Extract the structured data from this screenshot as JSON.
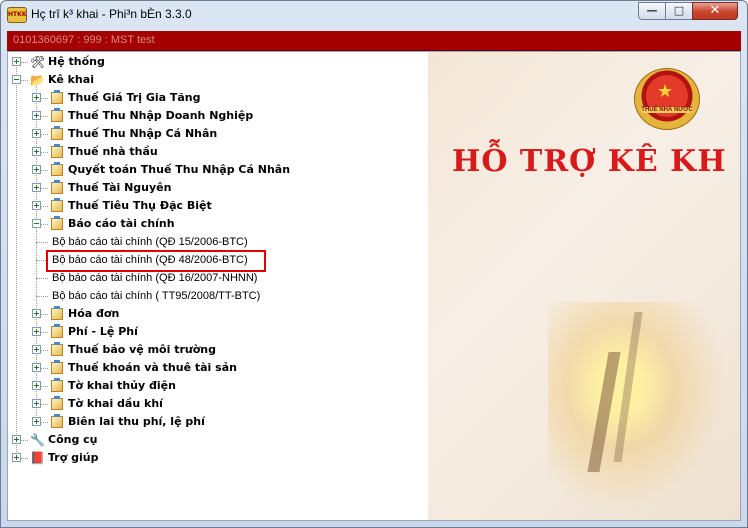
{
  "window": {
    "title": "Hç trî k³ khai - Phi³n bÈn 3.3.0",
    "app_icon_text": "HTKK",
    "buttons": {
      "minimize": "—",
      "maximize": "□",
      "close": "✕"
    }
  },
  "status": {
    "text": "0101360697 : 999 : MST test"
  },
  "tree": [
    {
      "label": "Hệ thống",
      "level": 0,
      "bold": true,
      "expander": "plus",
      "icon": "tools-icon"
    },
    {
      "label": "Kê khai",
      "level": 0,
      "bold": true,
      "expander": "minus",
      "icon": "folder-open-icon"
    },
    {
      "label": "Thuế Giá Trị Gia Tăng",
      "level": 1,
      "bold": true,
      "expander": "plus",
      "icon": "folder-icon"
    },
    {
      "label": "Thuế Thu Nhập Doanh Nghiệp",
      "level": 1,
      "bold": true,
      "expander": "plus",
      "icon": "folder-icon"
    },
    {
      "label": "Thuế Thu Nhập Cá Nhân",
      "level": 1,
      "bold": true,
      "expander": "plus",
      "icon": "folder-icon"
    },
    {
      "label": "Thuế nhà thầu",
      "level": 1,
      "bold": true,
      "expander": "plus",
      "icon": "folder-icon"
    },
    {
      "label": "Quyết toán Thuế Thu Nhập Cá Nhân",
      "level": 1,
      "bold": true,
      "expander": "plus",
      "icon": "folder-icon"
    },
    {
      "label": "Thuế Tài Nguyên",
      "level": 1,
      "bold": true,
      "expander": "plus",
      "icon": "folder-icon"
    },
    {
      "label": "Thuế Tiêu Thụ Đặc Biệt",
      "level": 1,
      "bold": true,
      "expander": "plus",
      "icon": "folder-icon"
    },
    {
      "label": "Báo cáo tài chính",
      "level": 1,
      "bold": true,
      "expander": "minus",
      "icon": "folder-icon"
    },
    {
      "label": "Bộ báo cáo tài chính (QĐ 15/2006-BTC)",
      "level": 2,
      "bold": false,
      "expander": "none",
      "icon": ""
    },
    {
      "label": "Bộ báo cáo tài chính (QĐ 48/2006-BTC)",
      "level": 2,
      "bold": false,
      "expander": "none",
      "icon": "",
      "highlighted": true
    },
    {
      "label": "Bộ báo cáo tài chính (QĐ 16/2007-NHNN)",
      "level": 2,
      "bold": false,
      "expander": "none",
      "icon": ""
    },
    {
      "label": "Bộ báo cáo tài chính ( TT95/2008/TT-BTC)",
      "level": 2,
      "bold": false,
      "expander": "none",
      "icon": ""
    },
    {
      "label": "Hóa đơn",
      "level": 1,
      "bold": true,
      "expander": "plus",
      "icon": "folder-icon"
    },
    {
      "label": "Phí - Lệ Phí",
      "level": 1,
      "bold": true,
      "expander": "plus",
      "icon": "folder-icon"
    },
    {
      "label": "Thuế bảo vệ môi trường",
      "level": 1,
      "bold": true,
      "expander": "plus",
      "icon": "folder-icon"
    },
    {
      "label": "Thuế khoán và thuê tài sản",
      "level": 1,
      "bold": true,
      "expander": "plus",
      "icon": "folder-icon"
    },
    {
      "label": "Tờ khai thủy điện",
      "level": 1,
      "bold": true,
      "expander": "plus",
      "icon": "folder-icon"
    },
    {
      "label": "Tờ khai dầu khí",
      "level": 1,
      "bold": true,
      "expander": "plus",
      "icon": "folder-icon"
    },
    {
      "label": "Biên lai thu phí, lệ phí",
      "level": 1,
      "bold": true,
      "expander": "plus",
      "icon": "folder-icon"
    },
    {
      "label": "Công cụ",
      "level": 0,
      "bold": true,
      "expander": "plus",
      "icon": "wrench-icon"
    },
    {
      "label": "Trợ giúp",
      "level": 0,
      "bold": true,
      "expander": "plus",
      "icon": "help-book-icon"
    }
  ],
  "banner": {
    "text": "HỖ TRỢ KÊ KH",
    "emblem_text": "THUẾ NHÀ NƯỚC",
    "color": "#d81a1a"
  },
  "colors": {
    "status_bar": "#a40000",
    "highlight_box": "#e30000"
  }
}
